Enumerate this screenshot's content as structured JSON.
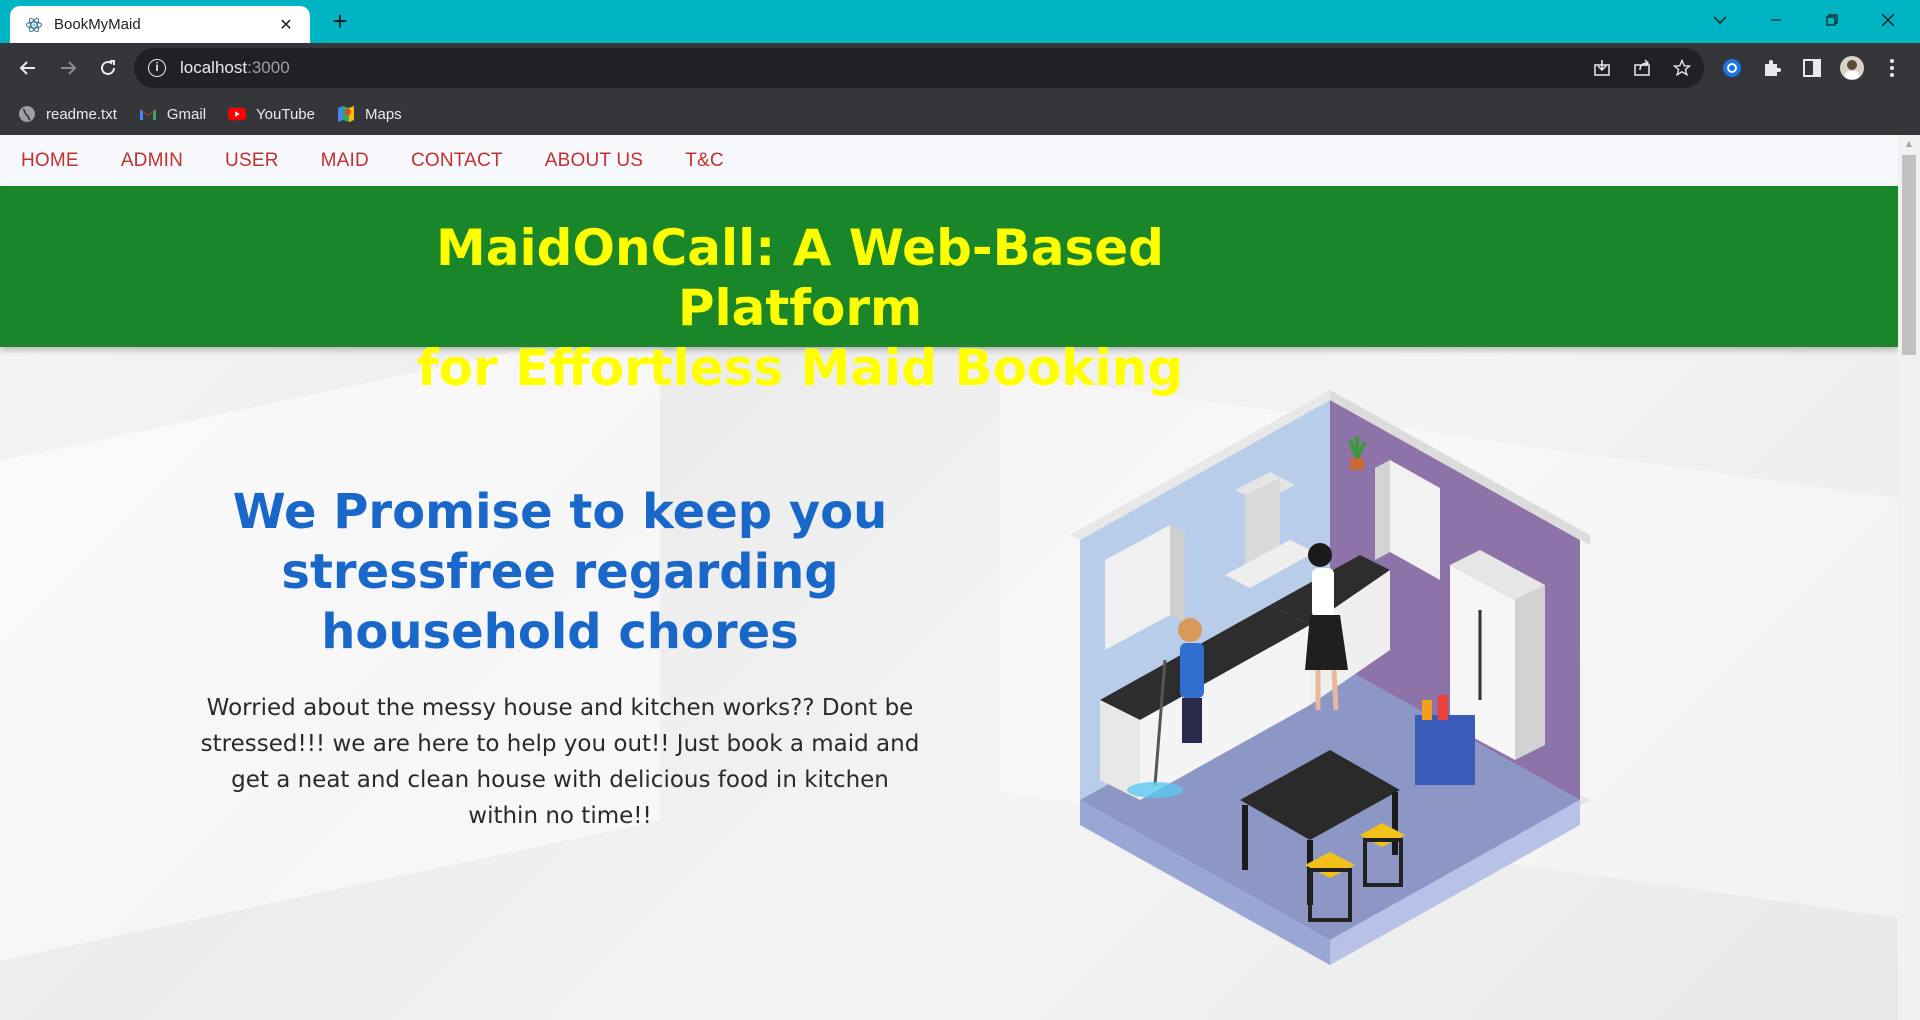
{
  "browser": {
    "tab_title": "BookMyMaid",
    "tab_close": "✕",
    "new_tab": "+",
    "url_host": "localhost",
    "url_port": ":3000",
    "bookmarks": [
      {
        "label": "readme.txt",
        "icon": "globe-icon"
      },
      {
        "label": "Gmail",
        "icon": "gmail-icon"
      },
      {
        "label": "YouTube",
        "icon": "youtube-icon"
      },
      {
        "label": "Maps",
        "icon": "maps-icon"
      }
    ],
    "accent_color": "#00b4c4"
  },
  "nav": {
    "items": [
      "HOME",
      "ADMIN",
      "USER",
      "MAID",
      "CONTACT",
      "ABOUT US",
      "T&C"
    ],
    "color": "#c1312f"
  },
  "banner": {
    "title_line1": "MaidOnCall: A Web-Based Platform",
    "title_line2": "for Effortless Maid Booking",
    "background": "#188629",
    "text_color": "#ffff00"
  },
  "hero": {
    "heading": "We Promise to keep you stressfree regarding household chores",
    "text": "Worried about the messy house and kitchen works?? Dont be stressed!!! we are here to help you out!! Just book a maid and get a neat and clean house with delicious food in kitchen within no time!!",
    "heading_color": "#1967c8"
  }
}
